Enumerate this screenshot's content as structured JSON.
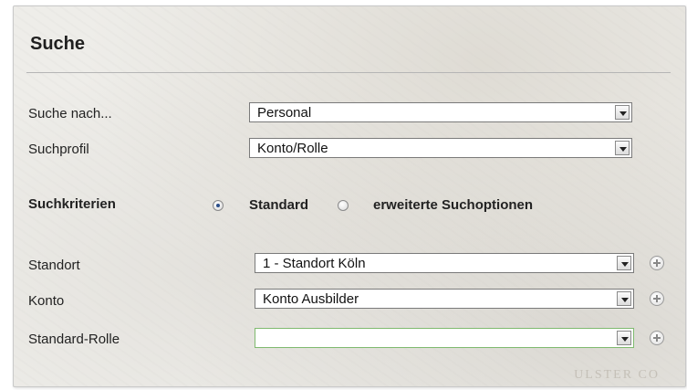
{
  "search_panel": {
    "title": "Suche",
    "search_for_label": "Suche nach...",
    "search_for_value": "Personal",
    "profile_label": "Suchprofil",
    "profile_value": "Konto/Rolle",
    "criteria_label": "Suchkriterien",
    "mode_standard_label": "Standard",
    "mode_extended_label": "erweiterte Suchoptionen",
    "selected_mode": "Standard",
    "location_label": "Standort",
    "location_value": "1 - Standort Köln",
    "account_label": "Konto",
    "account_value": "Konto Ausbilder",
    "role_label": "Standard-Rolle",
    "role_value": "",
    "watermark_text": "ULSTER CO"
  },
  "icons": {
    "dropdown": "chevron-down-icon",
    "add": "plus-circle-icon"
  },
  "colors": {
    "panel_background": "#eeede9",
    "focused_border": "#7fba6f",
    "radio_selected": "#2b4f8a"
  }
}
